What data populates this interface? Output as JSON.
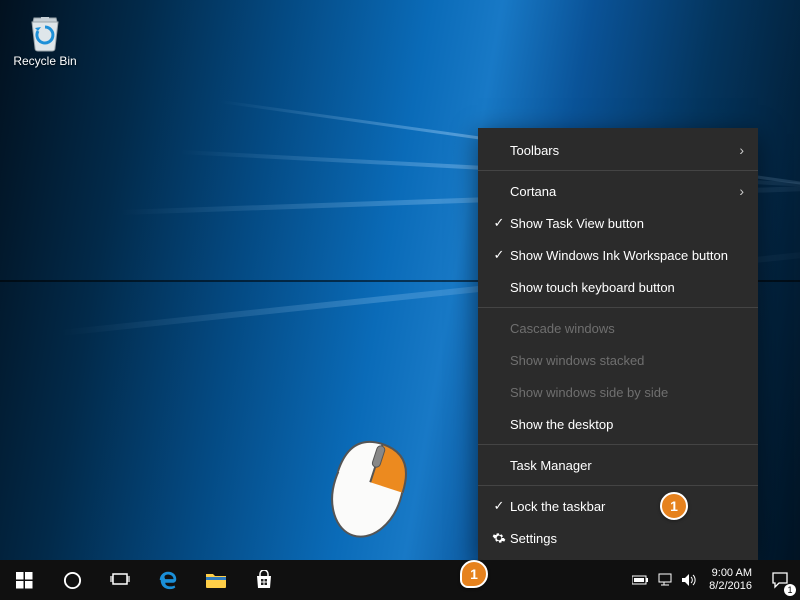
{
  "desktop": {
    "recycle_bin_label": "Recycle Bin"
  },
  "context_menu": {
    "items": {
      "toolbars": "Toolbars",
      "cortana": "Cortana",
      "show_task_view": "Show Task View button",
      "show_ink": "Show Windows Ink Workspace button",
      "show_touch_kb": "Show touch keyboard button",
      "cascade": "Cascade windows",
      "stacked": "Show windows stacked",
      "sidebyside": "Show windows side by side",
      "show_desktop": "Show the desktop",
      "task_manager": "Task Manager",
      "lock_taskbar": "Lock the taskbar",
      "settings": "Settings"
    }
  },
  "tray": {
    "time": "9:00 AM",
    "date": "8/2/2016",
    "notification_count": "1"
  },
  "annotations": {
    "badge1": "1",
    "badge2": "1"
  }
}
